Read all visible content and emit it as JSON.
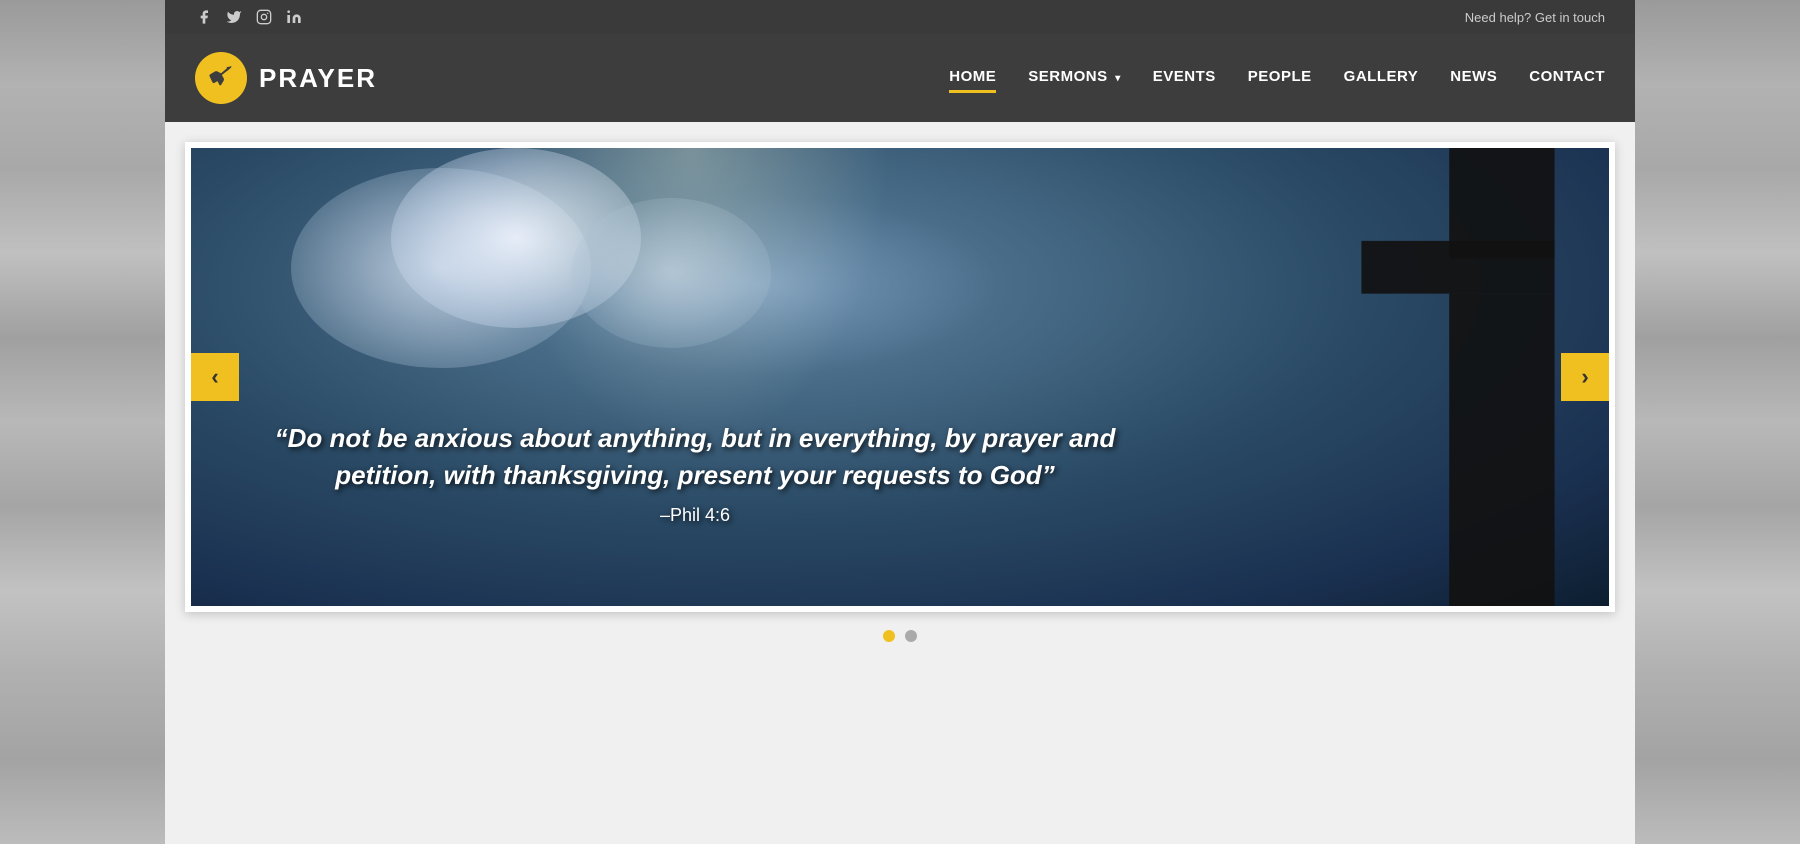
{
  "topbar": {
    "help_text": "Need help? Get in touch",
    "social": [
      {
        "name": "facebook",
        "icon": "f"
      },
      {
        "name": "twitter",
        "icon": "t"
      },
      {
        "name": "instagram",
        "icon": "i"
      },
      {
        "name": "linkedin",
        "icon": "in"
      }
    ]
  },
  "header": {
    "logo_text": "PRAYER",
    "nav_items": [
      {
        "label": "HOME",
        "active": true,
        "has_dropdown": false
      },
      {
        "label": "SERMONS",
        "active": false,
        "has_dropdown": true
      },
      {
        "label": "EVENTS",
        "active": false,
        "has_dropdown": false
      },
      {
        "label": "PEOPLE",
        "active": false,
        "has_dropdown": false
      },
      {
        "label": "GALLERY",
        "active": false,
        "has_dropdown": false
      },
      {
        "label": "NEWS",
        "active": false,
        "has_dropdown": false
      },
      {
        "label": "CONTACT",
        "active": false,
        "has_dropdown": false
      }
    ]
  },
  "slider": {
    "quote": "“Do not be anxious about anything, but in everything, by prayer and petition, with thanksgiving, present your requests to God”",
    "reference": "–Phil 4:6",
    "prev_label": "‹",
    "next_label": "›",
    "dots": [
      {
        "active": true
      },
      {
        "active": false
      }
    ]
  }
}
